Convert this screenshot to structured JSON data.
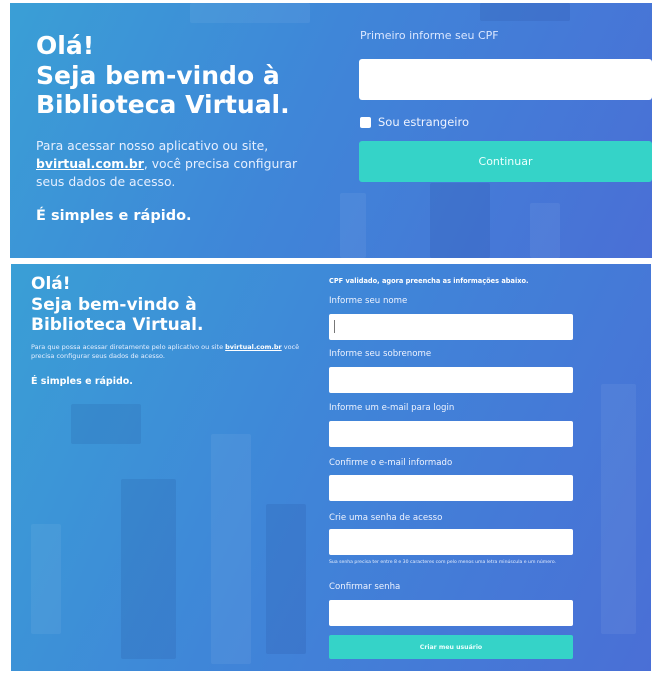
{
  "screen1": {
    "greeting_line1": "Olá!",
    "greeting_line2": "Seja bem-vindo à",
    "greeting_line3": "Biblioteca Virtual.",
    "desc_before": "Para acessar nosso aplicativo ou site, ",
    "desc_link": "bvirtual.com.br",
    "desc_after": ", você precisa configurar seus dados de acesso.",
    "simple": "É simples e rápido.",
    "cpf_label": "Primeiro informe seu CPF",
    "cpf_value": "",
    "foreign_label": "Sou estrangeiro",
    "continue_label": "Continuar"
  },
  "screen2": {
    "greeting_line1": "Olá!",
    "greeting_line2": "Seja bem-vindo à",
    "greeting_line3": "Biblioteca Virtual.",
    "desc_before": "Para que possa acessar diretamente pelo aplicativo ou site ",
    "desc_link": "bvirtual.com.br",
    "desc_after": " você precisa configurar seus dados de acesso.",
    "simple": "É simples e rápido.",
    "validated": "CPF validado, agora preencha as informações abaixo.",
    "fields": [
      {
        "label": "Informe seu nome",
        "value": ""
      },
      {
        "label": "Informe seu sobrenome",
        "value": ""
      },
      {
        "label": "Informe um e-mail para login",
        "value": ""
      },
      {
        "label": "Confirme o e-mail informado",
        "value": ""
      },
      {
        "label": "Crie uma senha de acesso",
        "value": ""
      },
      {
        "label": "Confirmar senha",
        "value": ""
      }
    ],
    "password_hint": "Sua senha precisa ter entre 8 e 30 caracteres com pelo menos uma letra minúscula e um número.",
    "create_label": "Criar meu usuário"
  },
  "colors": {
    "gradient_start": "#3a9fd6",
    "gradient_end": "#4a6fd6",
    "accent_button": "#35d3c8"
  }
}
